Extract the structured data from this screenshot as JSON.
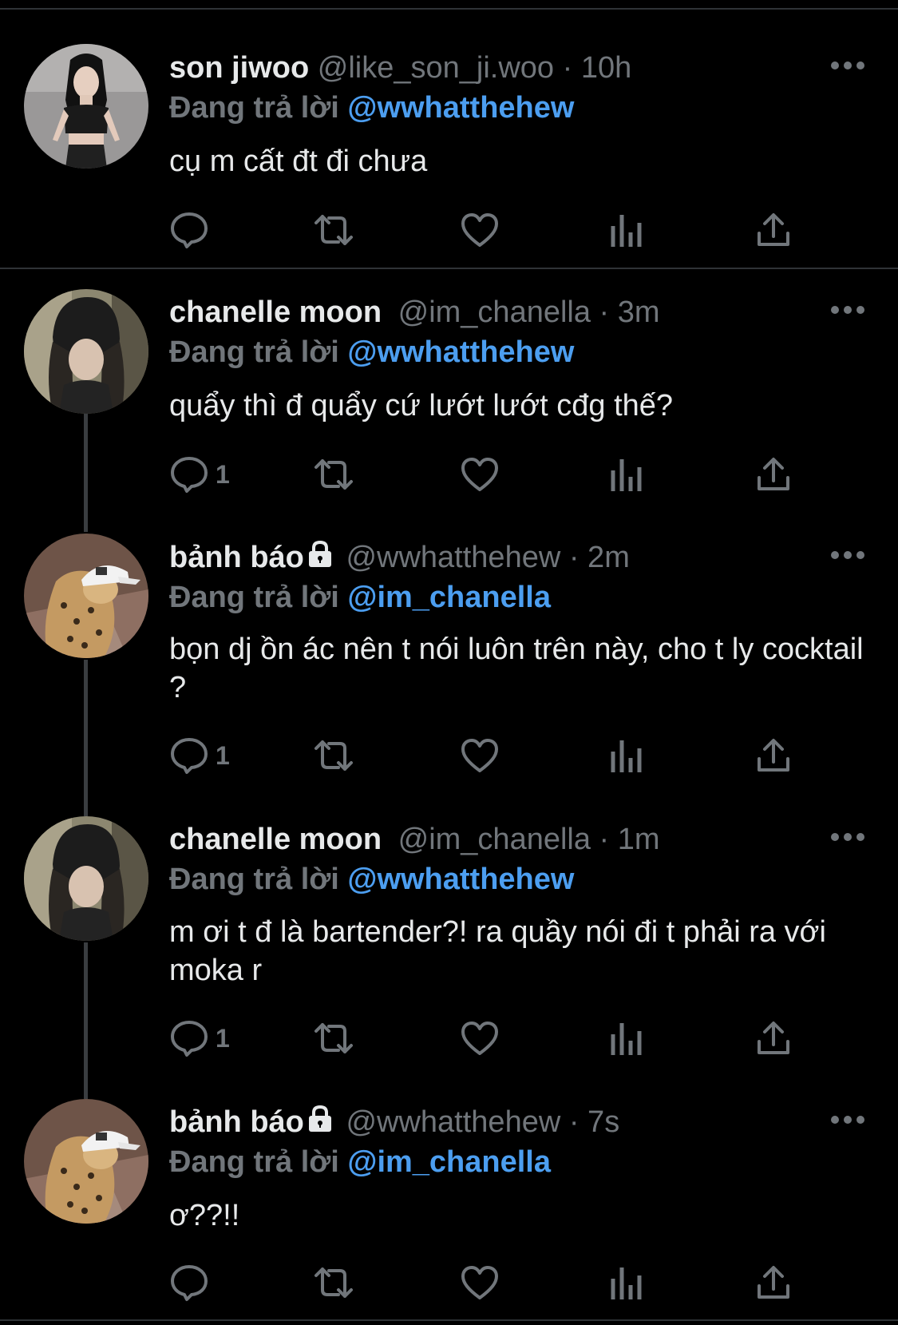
{
  "tweets": [
    {
      "name": "son jiwoo",
      "locked": false,
      "handle": "@like_son_ji.woo",
      "time": "· 10h",
      "replying_prefix": "Đang trả lời",
      "replying_to": "@wwhatthehew",
      "text": "cụ m cất đt đi chưa",
      "reply_count": "",
      "avatar_icon": "avatar-girl-crop-top"
    },
    {
      "name": "chanelle moon",
      "locked": false,
      "handle": "@im_chanella",
      "time": "· 3m",
      "replying_prefix": "Đang trả lời",
      "replying_to": "@wwhatthehew",
      "text": "quẩy thì đ quẩy cứ lướt lướt cđg thế?",
      "reply_count": "1",
      "avatar_icon": "avatar-girl-beanie"
    },
    {
      "name": "bảnh báo",
      "locked": true,
      "handle": "@wwhatthehew",
      "time": "· 2m",
      "replying_prefix": "Đang trả lời",
      "replying_to": "@im_chanella",
      "text": "bọn dj ồn ác nên t nói luôn trên này, cho t ly cocktail ?",
      "reply_count": "1",
      "avatar_icon": "avatar-leopard-cap"
    },
    {
      "name": "chanelle moon",
      "locked": false,
      "handle": "@im_chanella",
      "time": "· 1m",
      "replying_prefix": "Đang trả lời",
      "replying_to": "@wwhatthehew",
      "text": "m ơi t đ là bartender?! ra quầy nói đi t phải ra với moka r",
      "reply_count": "1",
      "avatar_icon": "avatar-girl-beanie"
    },
    {
      "name": "bảnh báo",
      "locked": true,
      "handle": "@wwhatthehew",
      "time": "· 7s",
      "replying_prefix": "Đang trả lời",
      "replying_to": "@im_chanella",
      "text": "ơ??!!",
      "reply_count": "",
      "avatar_icon": "avatar-leopard-cap"
    }
  ],
  "icons": {
    "reply": "reply-icon",
    "retweet": "retweet-icon",
    "like": "like-icon",
    "views": "views-icon",
    "share": "share-icon",
    "more": "more-icon",
    "lock": "lock-icon"
  },
  "colors": {
    "background": "#000000",
    "text": "#e7e9ea",
    "muted": "#71767b",
    "mention": "#4c9ef0",
    "divider": "#2f3336"
  }
}
